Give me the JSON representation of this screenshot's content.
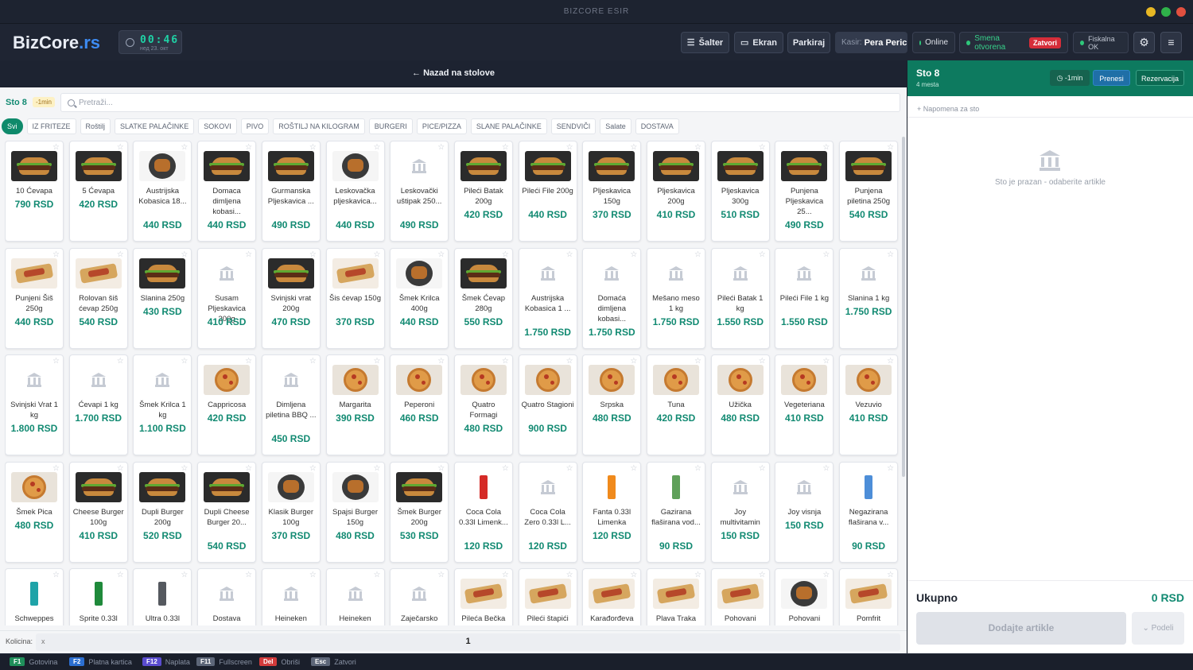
{
  "window": {
    "title": "BIZCORE ESIR"
  },
  "header": {
    "logo_main": "BizCore",
    "logo_suffix": ".rs",
    "clock_time": "00:46",
    "clock_date": "нед 23. окт",
    "salter_label": "Šalter",
    "ekran_label": "Ekran",
    "parkiraj_label": "Parkiraj",
    "kasir_label": "Kasir:",
    "kasir_name": "Pera Peric",
    "online_label": "Online",
    "smena_label": "Smena otvorena",
    "zatvori_label": "Zatvori",
    "fiskalna_label": "Fiskalna OK"
  },
  "backbar": {
    "label": "← Nazad na stolove"
  },
  "table": {
    "label": "Sto 8",
    "badge": "-1min"
  },
  "search": {
    "placeholder": "Pretraži..."
  },
  "categories": [
    "Svi",
    "IZ FRITEZE",
    "Roštilj",
    "SLATKE PALAČINKE",
    "SOKOVI",
    "PIVO",
    "ROŠTILJ NA KILOGRAM",
    "BURGERI",
    "PICE/PIZZA",
    "SLANE PALAČINKE",
    "SENDVIČI",
    "Salate",
    "DOSTAVA"
  ],
  "active_category": "Svi",
  "products": [
    {
      "name": "10 Ćevapa",
      "price": "790 RSD",
      "img": "burger"
    },
    {
      "name": "5 Ćevapa",
      "price": "420 RSD",
      "img": "burger"
    },
    {
      "name": "Austrijska Kobasica 18...",
      "price": "440 RSD",
      "img": "plate"
    },
    {
      "name": "Domaca dimljena kobasi...",
      "price": "440 RSD",
      "img": "burger"
    },
    {
      "name": "Gurmanska Pljeskavica ...",
      "price": "490 RSD",
      "img": "burger"
    },
    {
      "name": "Leskovačka pljeskavica...",
      "price": "440 RSD",
      "img": "plate"
    },
    {
      "name": "Leskovački uštipak 250...",
      "price": "490 RSD",
      "img": "ph"
    },
    {
      "name": "Pileći Batak 200g",
      "price": "420 RSD",
      "img": "burger"
    },
    {
      "name": "Pileći File 200g",
      "price": "440 RSD",
      "img": "burger"
    },
    {
      "name": "Pljeskavica 150g",
      "price": "370 RSD",
      "img": "burger"
    },
    {
      "name": "Pljeskavica 200g",
      "price": "410 RSD",
      "img": "burger"
    },
    {
      "name": "Pljeskavica 300g",
      "price": "510 RSD",
      "img": "burger"
    },
    {
      "name": "Punjena Pljeskavica 25...",
      "price": "490 RSD",
      "img": "burger"
    },
    {
      "name": "Punjena piletina 250g",
      "price": "540 RSD",
      "img": "burger"
    },
    {
      "name": "Punjeni Šiš 250g",
      "price": "440 RSD",
      "img": "wrap"
    },
    {
      "name": "Rolovan šiš ćevap 250g",
      "price": "540 RSD",
      "img": "wrap"
    },
    {
      "name": "Slanina 250g",
      "price": "430 RSD",
      "img": "burger"
    },
    {
      "name": "Susam Pljeskavica 200g",
      "price": "410 RSD",
      "img": "ph"
    },
    {
      "name": "Svinjski vrat 200g",
      "price": "470 RSD",
      "img": "burger"
    },
    {
      "name": "Šis ćevap 150g",
      "price": "370 RSD",
      "img": "wrap"
    },
    {
      "name": "Šmek Krilca 400g",
      "price": "440 RSD",
      "img": "plate"
    },
    {
      "name": "Šmek Ćevap 280g",
      "price": "550 RSD",
      "img": "burger"
    },
    {
      "name": "Austrijska Kobasica 1 ...",
      "price": "1.750 RSD",
      "img": "ph"
    },
    {
      "name": "Domaća dimljena kobasi...",
      "price": "1.750 RSD",
      "img": "ph"
    },
    {
      "name": "Mešano meso 1 kg",
      "price": "1.750 RSD",
      "img": "ph"
    },
    {
      "name": "Pileći Batak 1 kg",
      "price": "1.550 RSD",
      "img": "ph"
    },
    {
      "name": "Pileći File 1 kg",
      "price": "1.550 RSD",
      "img": "ph"
    },
    {
      "name": "Slanina 1 kg",
      "price": "1.750 RSD",
      "img": "ph"
    },
    {
      "name": "Svinjski Vrat 1 kg",
      "price": "1.800 RSD",
      "img": "ph"
    },
    {
      "name": "Ćevapi 1 kg",
      "price": "1.700 RSD",
      "img": "ph"
    },
    {
      "name": "Šmek Krilca 1 kg",
      "price": "1.100 RSD",
      "img": "ph"
    },
    {
      "name": "Cappricosa",
      "price": "420 RSD",
      "img": "pizza"
    },
    {
      "name": "Dimljena piletina BBQ ...",
      "price": "450 RSD",
      "img": "ph"
    },
    {
      "name": "Margarita",
      "price": "390 RSD",
      "img": "pizza"
    },
    {
      "name": "Peperoni",
      "price": "460 RSD",
      "img": "pizza"
    },
    {
      "name": "Quatro Formagi",
      "price": "480 RSD",
      "img": "pizza"
    },
    {
      "name": "Quatro Stagioni",
      "price": "900 RSD",
      "img": "pizza"
    },
    {
      "name": "Srpska",
      "price": "480 RSD",
      "img": "pizza"
    },
    {
      "name": "Tuna",
      "price": "420 RSD",
      "img": "pizza"
    },
    {
      "name": "Užička",
      "price": "480 RSD",
      "img": "pizza"
    },
    {
      "name": "Vegeteriana",
      "price": "410 RSD",
      "img": "pizza"
    },
    {
      "name": "Vezuvio",
      "price": "410 RSD",
      "img": "pizza"
    },
    {
      "name": "Šmek Pica",
      "price": "480 RSD",
      "img": "pizza"
    },
    {
      "name": "Cheese Burger 100g",
      "price": "410 RSD",
      "img": "burger"
    },
    {
      "name": "Dupli Burger 200g",
      "price": "520 RSD",
      "img": "burger"
    },
    {
      "name": "Dupli Cheese Burger 20...",
      "price": "540 RSD",
      "img": "burger"
    },
    {
      "name": "Klasik Burger 100g",
      "price": "370 RSD",
      "img": "plate"
    },
    {
      "name": "Spajsi Burger 150g",
      "price": "480 RSD",
      "img": "plate"
    },
    {
      "name": "Šmek Burger 200g",
      "price": "530 RSD",
      "img": "burger"
    },
    {
      "name": "Coca Cola 0.33l Limenk...",
      "price": "120 RSD",
      "img": "can-red"
    },
    {
      "name": "Coca Cola Zero 0.33l L...",
      "price": "120 RSD",
      "img": "ph"
    },
    {
      "name": "Fanta 0.33l Limenka",
      "price": "120 RSD",
      "img": "can-orange"
    },
    {
      "name": "Gazirana flaširana vod...",
      "price": "90 RSD",
      "img": "can-green"
    },
    {
      "name": "Joy multivitamin",
      "price": "150 RSD",
      "img": "ph"
    },
    {
      "name": "Joy visnja",
      "price": "150 RSD",
      "img": "ph"
    },
    {
      "name": "Negazirana flaširana v...",
      "price": "90 RSD",
      "img": "can-blue"
    },
    {
      "name": "Schweppes",
      "price": "",
      "img": "can-teal"
    },
    {
      "name": "Sprite 0.33l",
      "price": "",
      "img": "can-green2"
    },
    {
      "name": "Ultra 0.33l",
      "price": "",
      "img": "can-gray"
    },
    {
      "name": "Dostava",
      "price": "",
      "img": "ph"
    },
    {
      "name": "Heineken",
      "price": "",
      "img": "ph"
    },
    {
      "name": "Heineken",
      "price": "",
      "img": "ph"
    },
    {
      "name": "Zaječarsko",
      "price": "",
      "img": "ph"
    },
    {
      "name": "Pileća Bečka",
      "price": "",
      "img": "wrap"
    },
    {
      "name": "Pileći štapići",
      "price": "",
      "img": "wrap"
    },
    {
      "name": "Karađorđeva",
      "price": "",
      "img": "wrap"
    },
    {
      "name": "Plava Traka",
      "price": "",
      "img": "wrap"
    },
    {
      "name": "Pohovani",
      "price": "",
      "img": "wrap"
    },
    {
      "name": "Pohovani",
      "price": "",
      "img": "plate"
    },
    {
      "name": "Pomfrit",
      "price": "",
      "img": "wrap"
    }
  ],
  "quantity": {
    "label": "Kolicina:",
    "prefix": "x",
    "value": "1"
  },
  "right_panel": {
    "title": "Sto 8",
    "subtitle": "4 mesta",
    "time_badge": "-1min",
    "prenesi_label": "Prenesi",
    "rezervacija_label": "Rezervacija",
    "napomena_label": "+ Napomena za sto",
    "empty_text": "Sto je prazan - odaberite artikle",
    "ukupno_label": "Ukupno",
    "total": "0 RSD",
    "dodajte_label": "Dodajte artikle",
    "podeli_label": "⌄ Podeli"
  },
  "footer": [
    {
      "key": "F1",
      "label": "Gotovina",
      "color": "#1f8f5a"
    },
    {
      "key": "F2",
      "label": "Platna kartica",
      "color": "#2c6fd1"
    },
    {
      "key": "F12",
      "label": "Naplata",
      "color": "#5a4ccf"
    },
    {
      "key": "F11",
      "label": "Fullscreen",
      "color": "#5d6678"
    },
    {
      "key": "Del",
      "label": "Obriši",
      "color": "#d23b3b"
    },
    {
      "key": "Esc",
      "label": "Zatvori",
      "color": "#5d6678"
    }
  ]
}
